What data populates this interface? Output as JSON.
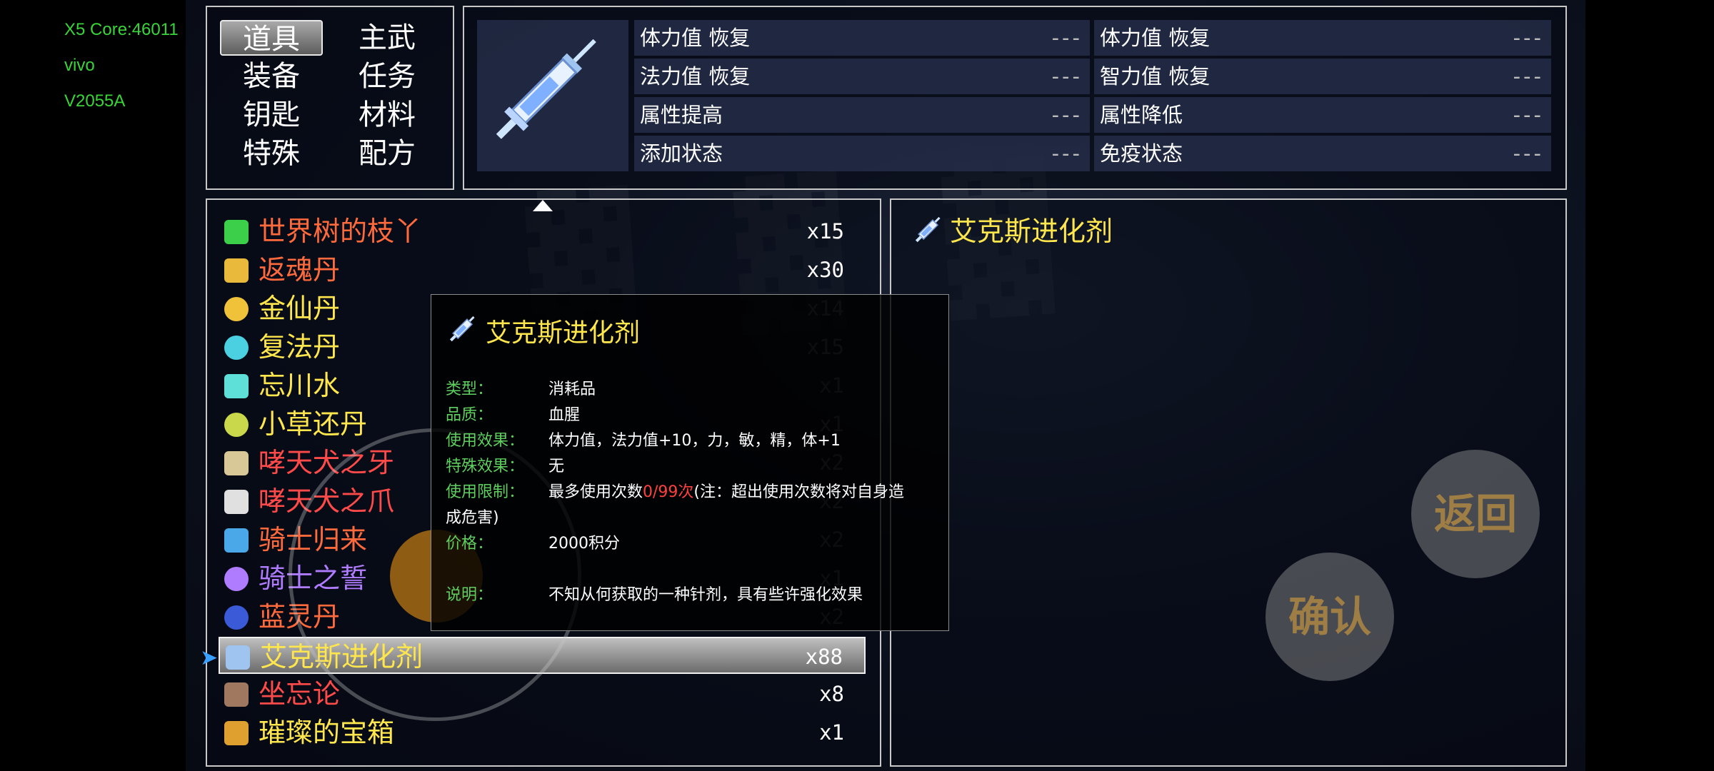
{
  "debug": [
    "X5 Core:46011",
    "vivo",
    "V2055A"
  ],
  "categories": [
    "道具",
    "主武",
    "装备",
    "任务",
    "钥匙",
    "材料",
    "特殊",
    "配方"
  ],
  "stats": [
    {
      "label": "体力值 恢复",
      "value": "---"
    },
    {
      "label": "体力值 恢复",
      "value": "---"
    },
    {
      "label": "法力值 恢复",
      "value": "---"
    },
    {
      "label": "智力值 恢复",
      "value": "---"
    },
    {
      "label": "属性提高",
      "value": "---"
    },
    {
      "label": "属性降低",
      "value": "---"
    },
    {
      "label": "添加状态",
      "value": "---"
    },
    {
      "label": "免疫状态",
      "value": "---"
    }
  ],
  "items": [
    {
      "name": "世界树的枝丫",
      "count": "x15",
      "color": "#ff6a3d",
      "icon": "clover-icon"
    },
    {
      "name": "返魂丹",
      "count": "x30",
      "color": "#ff6a3d",
      "icon": "feather-icon"
    },
    {
      "name": "金仙丹",
      "count": "x14",
      "color": "#ffe64d",
      "icon": "gold-pill-icon"
    },
    {
      "name": "复法丹",
      "count": "x15",
      "color": "#ffe64d",
      "icon": "blue-pill-icon"
    },
    {
      "name": "忘川水",
      "count": "x1",
      "color": "#ffe64d",
      "icon": "water-drop-icon"
    },
    {
      "name": "小草还丹",
      "count": "x1",
      "color": "#ffe64d",
      "icon": "herb-pill-icon"
    },
    {
      "name": "哮天犬之牙",
      "count": "x2",
      "color": "#ff4a4a",
      "icon": "fang-icon"
    },
    {
      "name": "哮天犬之爪",
      "count": "x2",
      "color": "#ff4a4a",
      "icon": "claw-icon"
    },
    {
      "name": "骑士归来",
      "count": "x2",
      "color": "#ff6a3d",
      "icon": "eye-icon"
    },
    {
      "name": "骑士之誓",
      "count": "x1",
      "color": "#b07cff",
      "icon": "orb-icon"
    },
    {
      "name": "蓝灵丹",
      "count": "x2",
      "color": "#ff6a3d",
      "icon": "blue-orb-icon"
    },
    {
      "name": "艾克斯进化剂",
      "count": "x88",
      "color": "#ffe64d",
      "icon": "syringe-icon"
    },
    {
      "name": "坐忘论",
      "count": "x8",
      "color": "#ff4a4a",
      "icon": "book-icon"
    },
    {
      "name": "璀璨的宝箱",
      "count": "x1",
      "color": "#ffe64d",
      "icon": "chest-icon"
    }
  ],
  "selected_index": 11,
  "detail": {
    "name": "艾克斯进化剂"
  },
  "tooltip": {
    "title": "艾克斯进化剂",
    "rows": [
      {
        "k": "类型：",
        "v": "消耗品"
      },
      {
        "k": "品质：",
        "v": "血腥"
      },
      {
        "k": "使用效果：",
        "v": "体力值，法力值+10，力，敏，精，体+1"
      },
      {
        "k": "特殊效果：",
        "v": "无"
      },
      {
        "k": "使用限制：",
        "v_pre": "最多使用次数",
        "v_red": "0/99次",
        "v_post": "(注：超出使用次数将对自身造",
        "v2": "成危害)"
      },
      {
        "k": "价格：",
        "v": "2000积分"
      },
      {
        "k": "说明：",
        "v": "不知从何获取的一种针剂，具有些许强化效果"
      }
    ]
  },
  "buttons": {
    "back": "返回",
    "confirm": "确认"
  }
}
